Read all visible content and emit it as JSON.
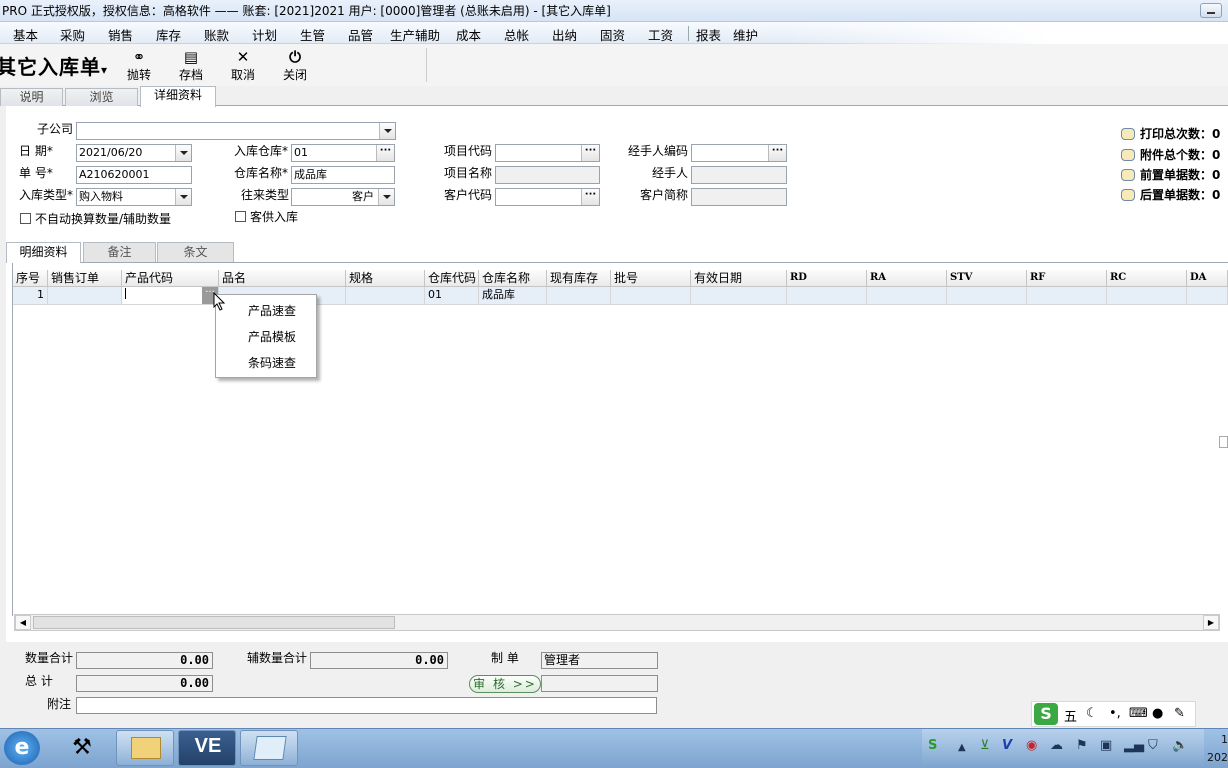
{
  "titlebar": {
    "text": "PRO 正式授权版，授权信息：高格软件   —— 账套: [2021]2021   用户: [0000]管理者      (总账未启用)       - [其它入库单]"
  },
  "menu": [
    "基本",
    "采购",
    "销售",
    "库存",
    "账款",
    "计划",
    "生管",
    "品管",
    "生产辅助",
    "成本",
    "总帐",
    "出纳",
    "固资",
    "工资",
    "报表",
    "维护"
  ],
  "toolbar": {
    "form_title": "其它入库单",
    "form_title_arrow": "▾",
    "buttons": [
      "抛转",
      "存档",
      "取消",
      "关闭"
    ]
  },
  "tabs": [
    "说明",
    "浏览",
    "详细资料"
  ],
  "form": {
    "subsidiary_label": "子公司",
    "subsidiary_value": "",
    "date_label": "日      期*",
    "date_value": "2021/06/20",
    "number_label": "单      号*",
    "number_value": "A210620001",
    "type_label": "入库类型*",
    "type_value": "购入物料",
    "warehouse_label": "入库仓库*",
    "warehouse_value": "01",
    "warehouse_name_label": "仓库名称*",
    "warehouse_name_value": "成品库",
    "partner_type_label": "往来类型",
    "partner_type_value": "客户",
    "project_code_label": "项目代码",
    "project_code_value": "",
    "project_name_label": "项目名称",
    "project_name_value": "",
    "customer_code_label": "客户代码",
    "customer_code_value": "",
    "handler_code_label": "经手人编码",
    "handler_code_value": "",
    "handler_label": "经手人",
    "handler_value": "",
    "customer_short_label": "客户简称",
    "customer_short_value": "",
    "check_auto_label": "不自动换算数量/辅助数量",
    "check_customer_label": "客供入库"
  },
  "stats": [
    "打印总次数：0",
    "附件总个数：0",
    "前置单据数：0",
    "后置单据数：0"
  ],
  "detail_tabs": [
    "明细资料",
    "备注",
    "条文"
  ],
  "grid": {
    "headers": [
      "序号",
      "销售订单",
      "产品代码",
      "品名",
      "规格",
      "仓库代码",
      "仓库名称",
      "现有库存",
      "批号",
      "有效日期",
      "RD",
      "RA",
      "STV",
      "RF",
      "RC",
      "DA"
    ],
    "row": [
      "1",
      "",
      "",
      "",
      "",
      "01",
      "成品库",
      "",
      "",
      "",
      "",
      "",
      "",
      "",
      "",
      ""
    ]
  },
  "popup": [
    "产品速查",
    "产品模板",
    "条码速查"
  ],
  "footer": {
    "qty_label": "数量合计",
    "qty_value": "0.00",
    "aux_label": "辅数量合计",
    "aux_value": "0.00",
    "maker_label": "制      单",
    "maker_value": "管理者",
    "total_label": "总      计",
    "total_value": "0.00",
    "audit_label": "审 核 >>",
    "note_label": "附注",
    "note_value": ""
  },
  "ime": {
    "logo": "S",
    "mode": "五"
  },
  "taskbar": {
    "clock": "1\n202",
    "app_ve": "VE"
  }
}
